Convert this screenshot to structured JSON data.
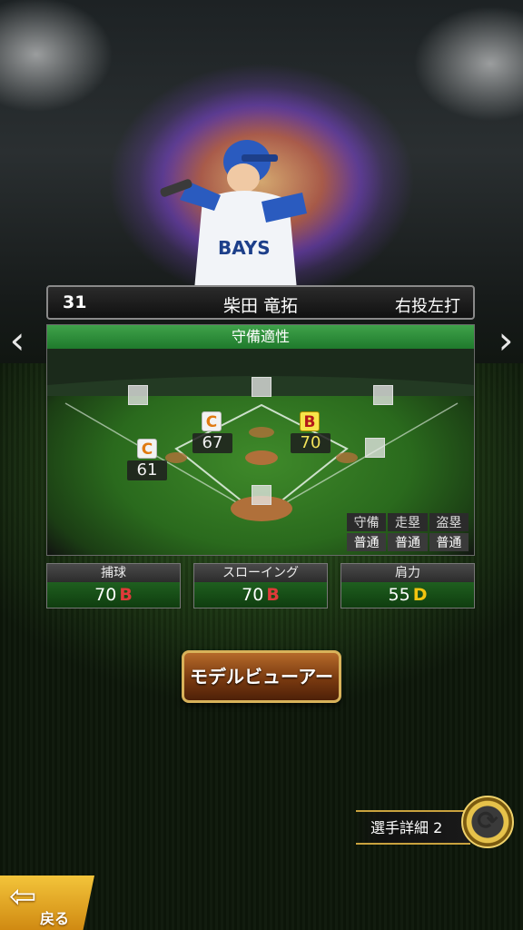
{
  "player": {
    "number": "31",
    "name": "柴田 竜拓",
    "handedness": "右投左打"
  },
  "field": {
    "header": "守備適性",
    "positions": [
      {
        "id": "second",
        "grade": "B",
        "value": "70"
      },
      {
        "id": "shortstop",
        "grade": "C",
        "value": "67"
      },
      {
        "id": "third",
        "grade": "C",
        "value": "61"
      }
    ],
    "aux": {
      "headers": [
        "守備",
        "走塁",
        "盗塁"
      ],
      "values": [
        "普通",
        "普通",
        "普通"
      ]
    }
  },
  "stats": [
    {
      "label": "捕球",
      "value": "70",
      "grade": "B"
    },
    {
      "label": "スローイング",
      "value": "70",
      "grade": "B"
    },
    {
      "label": "肩力",
      "value": "55",
      "grade": "D"
    }
  ],
  "buttons": {
    "model_viewer": "モデルビューアー",
    "player_detail": "選手詳細 2",
    "back": "戻る"
  },
  "icons": {
    "prev": "chevron-left-icon",
    "next": "chevron-right-icon",
    "swap": "swap-arrows-icon",
    "back": "back-arrow-icon"
  },
  "colors": {
    "grade_B": "#f7e54a",
    "grade_C": "#e07a10",
    "grade_D": "#f2c40f",
    "header_green": "#2f8f3a",
    "button_gold": "#d8b25a"
  }
}
